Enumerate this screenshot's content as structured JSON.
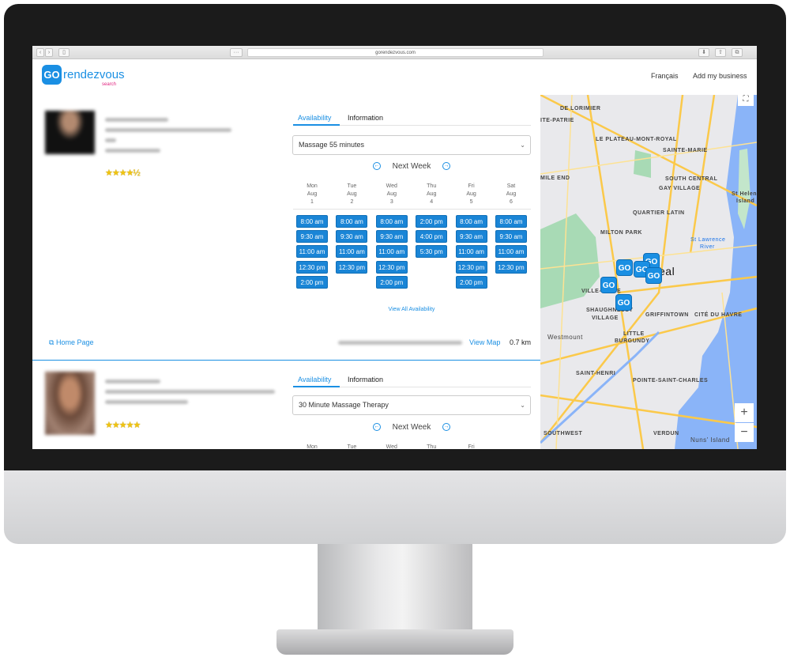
{
  "browser": {
    "url": "gorendezvous.com"
  },
  "header": {
    "logo_mark": "GO",
    "logo_word": "rendezvous",
    "logo_sub": "search",
    "nav": [
      "Français",
      "Add my business"
    ]
  },
  "colors": {
    "accent": "#1a8fe3",
    "logo_sub": "#e0237f",
    "slot": "#1a85d6"
  },
  "listings": [
    {
      "rating": 4.5,
      "stars": "★★★★½",
      "tabs": [
        "Availability",
        "Information"
      ],
      "service": "Massage 55 minutes",
      "week_label": "Next Week",
      "days": [
        {
          "dow": "Mon",
          "month": "Aug",
          "day": "1",
          "slots": [
            "8:00 am",
            "9:30 am",
            "11:00 am",
            "12:30 pm",
            "2:00 pm"
          ]
        },
        {
          "dow": "Tue",
          "month": "Aug",
          "day": "2",
          "slots": [
            "8:00 am",
            "9:30 am",
            "11:00 am",
            "12:30 pm"
          ]
        },
        {
          "dow": "Wed",
          "month": "Aug",
          "day": "3",
          "slots": [
            "8:00 am",
            "9:30 am",
            "11:00 am",
            "12:30 pm",
            "2:00 pm"
          ]
        },
        {
          "dow": "Thu",
          "month": "Aug",
          "day": "4",
          "slots": [
            "2:00 pm",
            "4:00 pm",
            "5:30 pm"
          ]
        },
        {
          "dow": "Fri",
          "month": "Aug",
          "day": "5",
          "slots": [
            "8:00 am",
            "9:30 am",
            "11:00 am",
            "12:30 pm",
            "2:00 pm"
          ]
        },
        {
          "dow": "Sat",
          "month": "Aug",
          "day": "6",
          "slots": [
            "8:00 am",
            "9:30 am",
            "11:00 am",
            "12:30 pm"
          ]
        }
      ],
      "view_all": "View All Availability",
      "home_page": "Home Page",
      "view_map": "View Map",
      "distance": "0.7 km"
    },
    {
      "rating": 5,
      "stars": "★★★★★",
      "tabs": [
        "Availability",
        "Information"
      ],
      "service": "30 Minute Massage Therapy",
      "week_label": "Next Week",
      "days": [
        {
          "dow": "Mon"
        },
        {
          "dow": "Tue"
        },
        {
          "dow": "Wed"
        },
        {
          "dow": "Thu"
        },
        {
          "dow": "Fri"
        }
      ]
    }
  ],
  "map": {
    "labels": [
      "DE LORIMIER",
      "ITE-PATRIE",
      "LE PLATEAU-MONT-ROYAL",
      "SAINTE-MARIE",
      "MILE END",
      "SOUTH CENTRAL",
      "GAY VILLAGE",
      "QUARTIER LATIN",
      "MILTON PARK",
      "VILLE-MARIE",
      "SHAUGHNESSY",
      "VILLAGE",
      "GRIFFINTOWN",
      "CITÉ DU HAVRE",
      "Westmount",
      "LITTLE",
      "BURGUNDY",
      "SAINT-HENRI",
      "POINTE-SAINT-CHARLES",
      "SOUTHWEST",
      "VERDUN",
      "Nuns' Island",
      "St Helen's",
      "Island",
      "St Lawrence",
      "River",
      "eal"
    ],
    "marker": "GO",
    "zoom_in": "+",
    "zoom_out": "−"
  }
}
